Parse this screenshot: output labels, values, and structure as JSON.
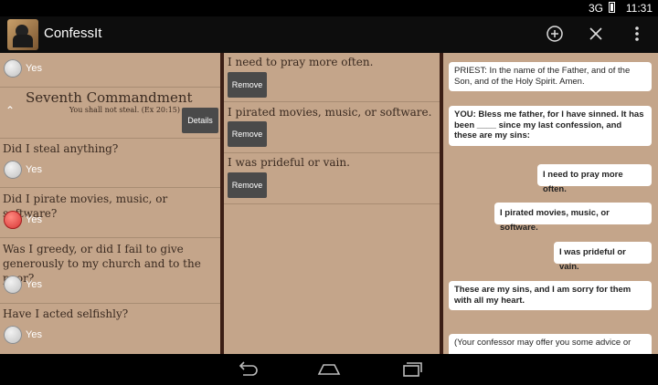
{
  "status": {
    "signal": "3G",
    "time": "11:31"
  },
  "appbar": {
    "title": "ConfessIt",
    "icons": [
      "add-icon",
      "close-icon",
      "overflow-menu-icon"
    ]
  },
  "left": {
    "top_yes": "Yes",
    "commandment": {
      "title": "Seventh Commandment",
      "subtitle": "You shall not steal. (Ex 20:15)",
      "details_label": "Details"
    },
    "questions": [
      {
        "text": "Did I steal anything?",
        "answer": "Yes",
        "checked": false
      },
      {
        "text": "Did I pirate movies, music, or software?",
        "answer": "Yes",
        "checked": true
      },
      {
        "text": "Was I greedy, or did I fail to give generously to my church and to the poor?",
        "answer": "Yes",
        "checked": false
      },
      {
        "text": "Have I acted selfishly?",
        "answer": "Yes",
        "checked": false
      }
    ]
  },
  "middle": {
    "sins": [
      {
        "text": "I need to pray more often.",
        "button": "Remove"
      },
      {
        "text": "I pirated movies, music, or software.",
        "button": "Remove"
      },
      {
        "text": "I was prideful or vain.",
        "button": "Remove"
      }
    ]
  },
  "right": {
    "messages": [
      {
        "speaker": "priest",
        "text": "PRIEST: In the name of the Father, and of the Son, and of the Holy Spirit. Amen."
      },
      {
        "speaker": "you",
        "text": "YOU: Bless me father, for I have sinned. It has been ____ since my last confession, and these are my sins:"
      },
      {
        "speaker": "you",
        "text": "I need to pray more often."
      },
      {
        "speaker": "you",
        "text": "I pirated movies, music, or software."
      },
      {
        "speaker": "you",
        "text": "I was prideful or vain."
      },
      {
        "speaker": "you",
        "text": "These are my sins, and I am sorry for them with all my heart."
      },
      {
        "speaker": "priest",
        "text": "(Your confessor may offer you some advice or"
      }
    ]
  },
  "navbar": {
    "icons": [
      "back-icon",
      "home-icon",
      "recent-apps-icon"
    ]
  },
  "colors": {
    "pane": "#c4a58a",
    "divider": "#3b1e15",
    "button": "#4a4a4a",
    "checked": "#d32f2f"
  }
}
